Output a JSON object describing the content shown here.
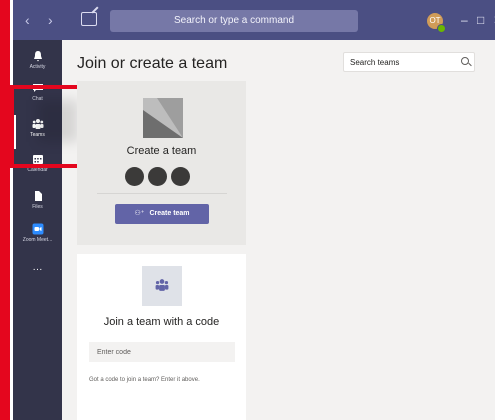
{
  "titlebar": {
    "back_glyph": "‹",
    "forward_glyph": "›",
    "search_text": "Search or type a command",
    "avatar_initials": "OT",
    "minimize_glyph": "–",
    "maximize_glyph": "□",
    "close_glyph": "✕"
  },
  "rail": {
    "items": [
      {
        "label": "Activity",
        "icon": "bell-icon"
      },
      {
        "label": "Chat",
        "icon": "chat-icon"
      },
      {
        "label": "Teams",
        "icon": "teams-icon",
        "active": true
      },
      {
        "label": "Calendar",
        "icon": "calendar-icon"
      },
      {
        "label": "Files",
        "icon": "files-icon"
      },
      {
        "label": "Zoom Meet...",
        "icon": "zoom-icon"
      }
    ],
    "more_glyph": "···"
  },
  "main": {
    "heading": "Join or create a team",
    "team_search_placeholder": "Search teams"
  },
  "create_card": {
    "title": "Create a team",
    "button_label": "Create team"
  },
  "join_card": {
    "title": "Join a team with a code",
    "code_placeholder": "Enter code",
    "hint": "Got a code to join a team? Enter it above."
  },
  "colors": {
    "titlebar": "#4b4f83",
    "rail": "#33344a",
    "accent": "#6264a7",
    "annotation": "#e4061e"
  }
}
